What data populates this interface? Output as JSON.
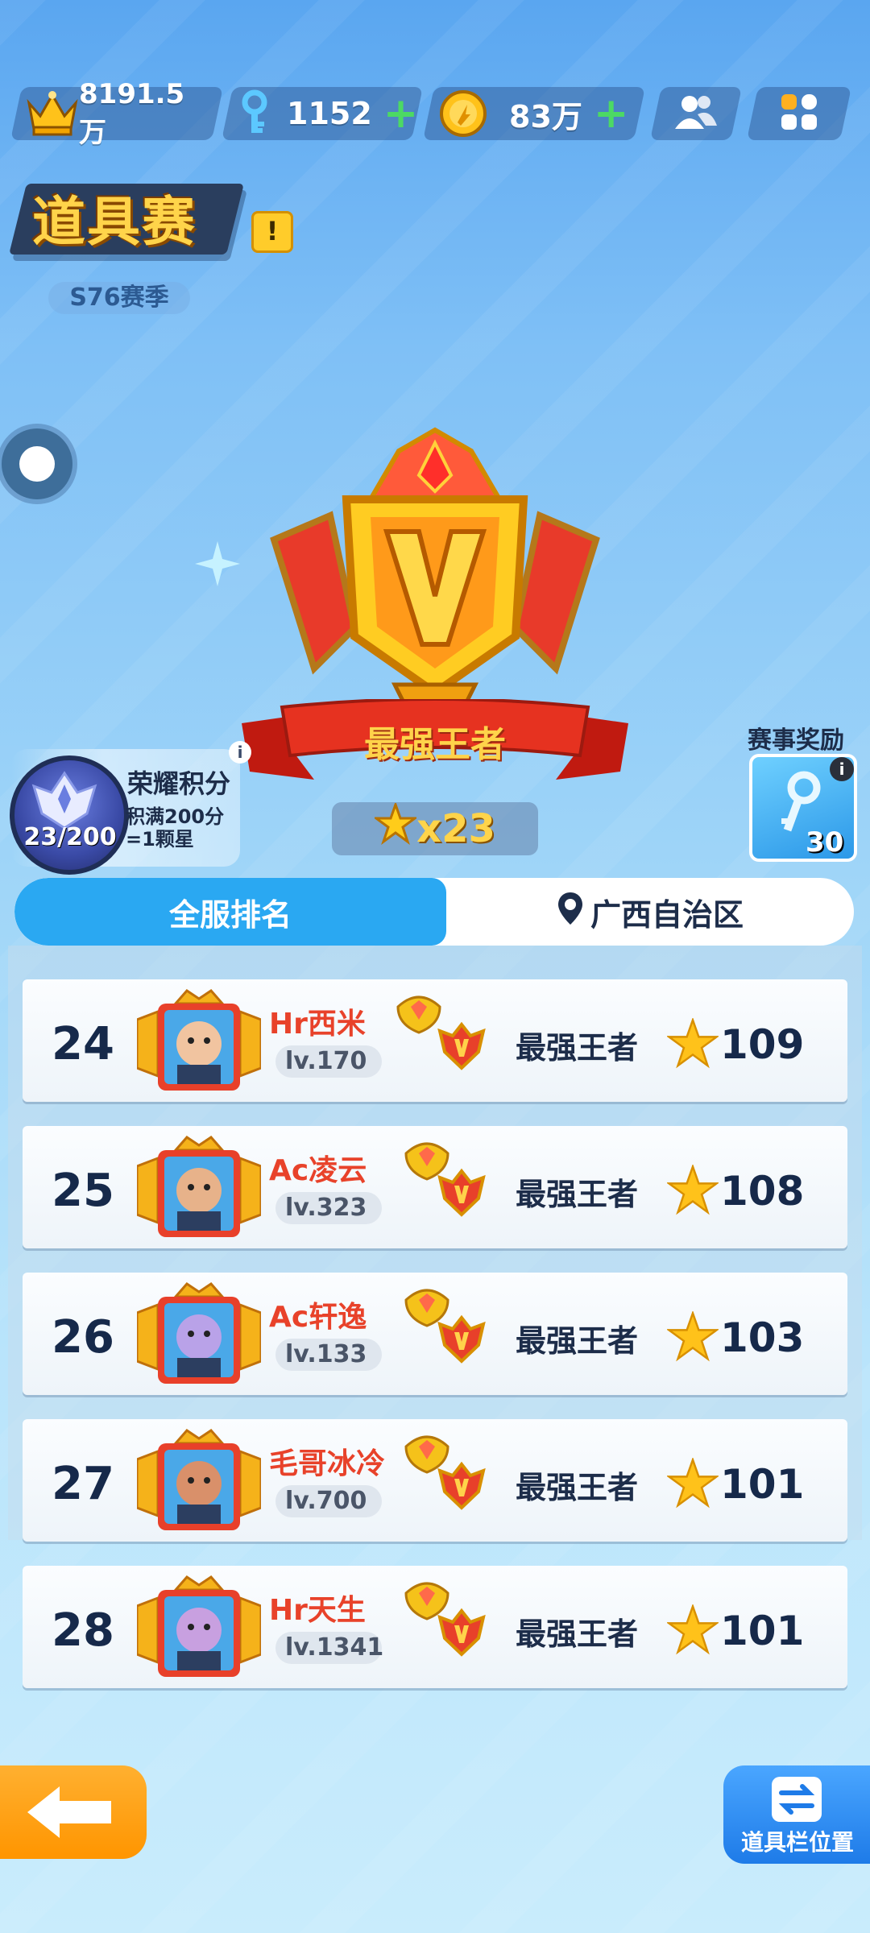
{
  "currency": {
    "crown_value": "8191.5万",
    "keys_value": "1152",
    "coins_value": "83万",
    "plus_symbol": "+"
  },
  "mode": {
    "title": "道具赛",
    "info_symbol": "!",
    "season": "S76赛季"
  },
  "trophy": {
    "rank_name": "最强王者",
    "star_count": "x23"
  },
  "honor": {
    "title": "荣耀积分",
    "desc_line1": "积满200分",
    "desc_line2": "=1颗星",
    "progress": "23/200",
    "info_symbol": "i"
  },
  "reward": {
    "label": "赛事奖励",
    "count": "30",
    "info_symbol": "i"
  },
  "tabs": {
    "global": "全服排名",
    "region": "广西自治区"
  },
  "leaderboard": [
    {
      "rank": "24",
      "name": "Hr西米",
      "level": "lv.170",
      "tier": "最强王者",
      "stars": "109"
    },
    {
      "rank": "25",
      "name": "Ac凌云",
      "level": "lv.323",
      "tier": "最强王者",
      "stars": "108"
    },
    {
      "rank": "26",
      "name": "Ac轩逸",
      "level": "lv.133",
      "tier": "最强王者",
      "stars": "103"
    },
    {
      "rank": "27",
      "name": "毛哥冰冷",
      "level": "lv.700",
      "tier": "最强王者",
      "stars": "101"
    },
    {
      "rank": "28",
      "name": "Hr天生",
      "level": "lv.1341",
      "tier": "最强王者",
      "stars": "101"
    }
  ],
  "bottom": {
    "slot_position_label": "道具栏位置"
  },
  "colors": {
    "accent_blue": "#2aa8f2",
    "name_red": "#e8422a",
    "gold": "#ffd44a"
  }
}
